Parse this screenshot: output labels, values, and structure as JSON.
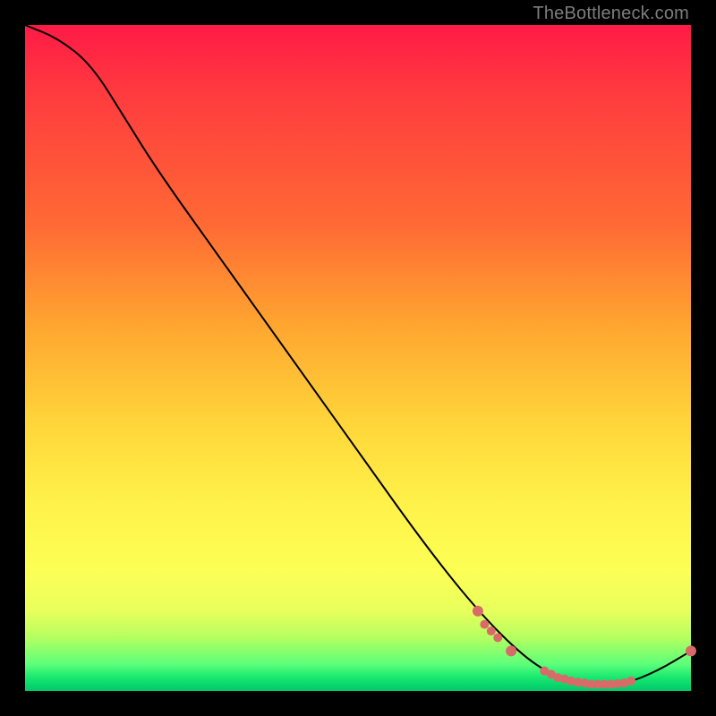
{
  "watermark": "TheBottleneck.com",
  "chart_data": {
    "type": "line",
    "title": "",
    "xlabel": "",
    "ylabel": "",
    "xlim": [
      0,
      100
    ],
    "ylim": [
      0,
      100
    ],
    "grid": false,
    "series": [
      {
        "name": "curve",
        "color": "#000000",
        "points": [
          {
            "x": 0,
            "y": 100
          },
          {
            "x": 5,
            "y": 98
          },
          {
            "x": 10,
            "y": 94
          },
          {
            "x": 15,
            "y": 86
          },
          {
            "x": 20,
            "y": 78
          },
          {
            "x": 30,
            "y": 64
          },
          {
            "x": 40,
            "y": 50
          },
          {
            "x": 50,
            "y": 36
          },
          {
            "x": 60,
            "y": 22
          },
          {
            "x": 68,
            "y": 12
          },
          {
            "x": 75,
            "y": 5
          },
          {
            "x": 80,
            "y": 2
          },
          {
            "x": 85,
            "y": 1
          },
          {
            "x": 90,
            "y": 1
          },
          {
            "x": 95,
            "y": 3
          },
          {
            "x": 100,
            "y": 6
          }
        ]
      }
    ],
    "markers": [
      {
        "x": 68,
        "y": 12,
        "r": 6,
        "color": "#d86a6a"
      },
      {
        "x": 69,
        "y": 10,
        "r": 5,
        "color": "#d86a6a"
      },
      {
        "x": 70,
        "y": 9,
        "r": 5,
        "color": "#d86a6a"
      },
      {
        "x": 71,
        "y": 8,
        "r": 5,
        "color": "#d86a6a"
      },
      {
        "x": 73,
        "y": 6,
        "r": 6,
        "color": "#d86a6a"
      },
      {
        "x": 78,
        "y": 3,
        "r": 5,
        "color": "#d86a6a"
      },
      {
        "x": 79,
        "y": 2.5,
        "r": 5,
        "color": "#d86a6a"
      },
      {
        "x": 80,
        "y": 2,
        "r": 5,
        "color": "#d86a6a"
      },
      {
        "x": 81,
        "y": 1.8,
        "r": 5,
        "color": "#d86a6a"
      },
      {
        "x": 82,
        "y": 1.5,
        "r": 5,
        "color": "#d86a6a"
      },
      {
        "x": 83,
        "y": 1.3,
        "r": 5,
        "color": "#d86a6a"
      },
      {
        "x": 84,
        "y": 1.2,
        "r": 5,
        "color": "#d86a6a"
      },
      {
        "x": 85,
        "y": 1.0,
        "r": 5,
        "color": "#d86a6a"
      },
      {
        "x": 86,
        "y": 1.0,
        "r": 5,
        "color": "#d86a6a"
      },
      {
        "x": 87,
        "y": 1.0,
        "r": 5,
        "color": "#d86a6a"
      },
      {
        "x": 88,
        "y": 1.0,
        "r": 5,
        "color": "#d86a6a"
      },
      {
        "x": 89,
        "y": 1.1,
        "r": 5,
        "color": "#d86a6a"
      },
      {
        "x": 90,
        "y": 1.2,
        "r": 5,
        "color": "#d86a6a"
      },
      {
        "x": 91,
        "y": 1.5,
        "r": 5,
        "color": "#d86a6a"
      },
      {
        "x": 100,
        "y": 6,
        "r": 6,
        "color": "#d86a6a"
      }
    ]
  }
}
